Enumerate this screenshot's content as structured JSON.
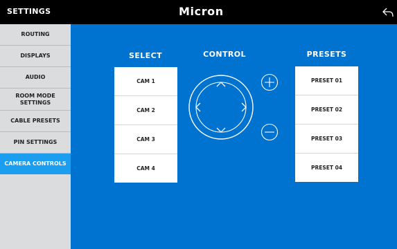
{
  "header": {
    "title": "SETTINGS",
    "brand": "Micron",
    "back_icon": "back-arrow-icon"
  },
  "sidebar": {
    "items": [
      {
        "label": "ROUTING",
        "active": false
      },
      {
        "label": "DISPLAYS",
        "active": false
      },
      {
        "label": "AUDIO",
        "active": false
      },
      {
        "label": "ROOM MODE SETTINGS",
        "active": false
      },
      {
        "label": "CABLE PRESETS",
        "active": false
      },
      {
        "label": "PIN SETTINGS",
        "active": false
      },
      {
        "label": "CAMERA CONTROLS",
        "active": true
      }
    ]
  },
  "main": {
    "select": {
      "heading": "SELECT",
      "cameras": [
        "CAM 1",
        "CAM 2",
        "CAM 3",
        "CAM 4"
      ]
    },
    "control": {
      "heading": "CONTROL",
      "icons": [
        "arrow-up-icon",
        "arrow-left-icon",
        "arrow-right-icon",
        "arrow-down-icon",
        "zoom-in-plus-icon",
        "zoom-out-minus-icon"
      ]
    },
    "presets": {
      "heading": "PRESETS",
      "items": [
        "PRESET 01",
        "PRESET 02",
        "PRESET 03",
        "PRESET 04"
      ]
    }
  },
  "colors": {
    "topbar": "#000000",
    "sidebar": "#dbdcde",
    "active_item": "#1b9df0",
    "main_bg": "#0073d0"
  }
}
